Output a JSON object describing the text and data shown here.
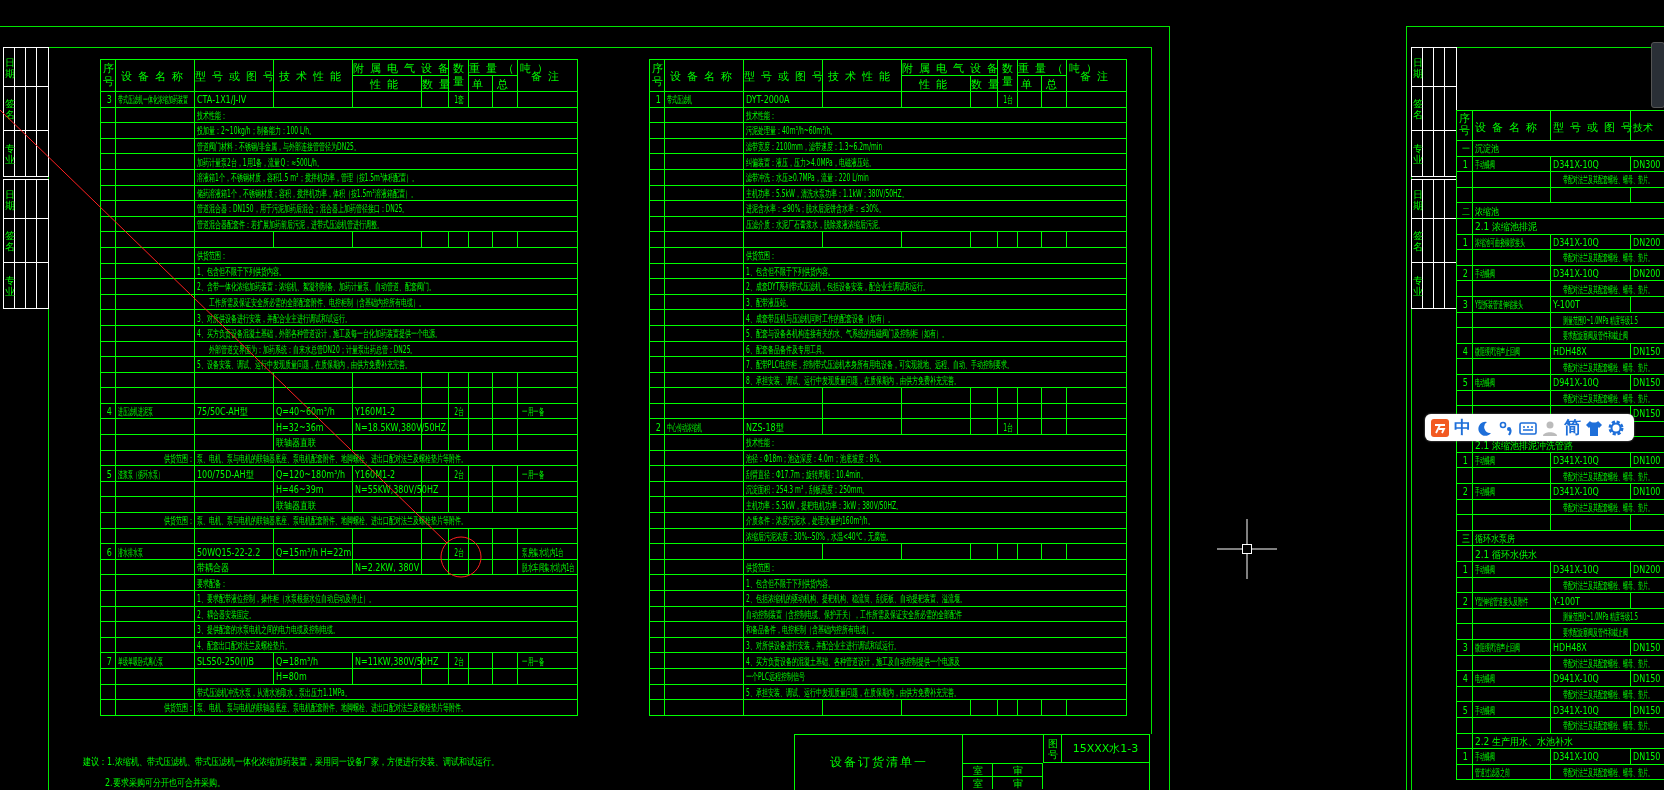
{
  "left_sheet": {
    "stamp_blocks": [
      [
        "日期",
        "签名",
        "专业"
      ],
      [
        "日期",
        "签名",
        "专业"
      ]
    ],
    "table": {
      "header": {
        "no": "序号",
        "name": "设备名称",
        "model": "型号或图号",
        "tech": "技术性能",
        "elec": "附属电气设备",
        "elec_perf": "性能",
        "elec_qty": "数量",
        "qty": "数量",
        "weight": "重量（吨）",
        "weight_unit": "单",
        "weight_total": "总",
        "remark": "备注"
      },
      "rows": [
        {
          "kind": "item",
          "no": "3",
          "name": "带式压滤机一体化浓缩加药装置",
          "model": "CTA-1X1/J-IV",
          "qty": "1套"
        },
        {
          "kind": "text",
          "text": "技术性能："
        },
        {
          "kind": "text",
          "text": "投加量：2~10kg/h；制备能力：100 L/h。"
        },
        {
          "kind": "text",
          "text": "管道阀门材料：不锈钢/非金属，与外部连接管管径为DN25。"
        },
        {
          "kind": "text",
          "text": "加药计量泵2台，1用1备，流量Q：≈500L/h。"
        },
        {
          "kind": "text",
          "text": "溶液箱1个，不锈钢材质，容积1.5 m³；搅拌机功率，管理（按1.5m³体积配置）。"
        },
        {
          "kind": "text",
          "text": "储药溶液箱1个，不锈钢材质；容积，搅拌机功率，体积（按1.5m³溶液箱配置）。"
        },
        {
          "kind": "text",
          "text": "管道混合器：DN150，用于污泥加药后混合；混合器上加药管径接口：DN25。"
        },
        {
          "kind": "text",
          "text": "管道混合器配套件：若扩展加药前后污泥，进带式压滤机管进行调整。"
        },
        {
          "kind": "blank"
        },
        {
          "kind": "text",
          "text": "供货范围："
        },
        {
          "kind": "text",
          "text": "1、包含但不限于下列供货内容。"
        },
        {
          "kind": "text",
          "text": "2、含带一体化浓缩加药装置：浓缩机、絮凝剂制备、加药计量泵、自动管道、配套阀门。"
        },
        {
          "kind": "text",
          "indent": true,
          "text": "工作所需及保证安全所必需的全部配套附件、电控柜制（含基础内控所有电缆）。"
        },
        {
          "kind": "text",
          "text": "3、对所供设备进行安装，并配合业主进行调试和试运行。"
        },
        {
          "kind": "text",
          "text": "4、买方负责设备混凝土基础，外部各种管道设计，施工及每一台化加药装置提供一个电源。"
        },
        {
          "kind": "text",
          "indent": true,
          "text": "外部管道交界面为：加药系统：自来水总管DN20；计量泵出药总管：DN25。"
        },
        {
          "kind": "text",
          "text": "5、设备安装、调试、运行中发现质量问题，在质保期内，由供方免费补充完善。"
        },
        {
          "kind": "blank"
        },
        {
          "kind": "blank"
        },
        {
          "kind": "item",
          "no": "4",
          "name": "进压滤机进泥泵",
          "model": "75/50C-AH型",
          "tech": "Q=40~60m³/h",
          "elec": "Y160M1-2",
          "qty": "2台",
          "remark": "一用一备"
        },
        {
          "kind": "item",
          "tech": "H=32~36m",
          "elec": "N=18.5KW,380V/50HZ"
        },
        {
          "kind": "item",
          "tech": "联轴器直联"
        },
        {
          "kind": "text",
          "label": "供货范围：",
          "text": "泵、电机、泵与电机的联轴器底座、泵电机配套附件、地脚螺栓、进出口配对法兰及螺栓垫片等附件。"
        },
        {
          "kind": "item",
          "no": "5",
          "name": "渣浆泵（循环水泵）",
          "model": "100/75D-AH型",
          "tech": "Q=120~180m³/h",
          "elec": "Y160M1-2",
          "qty": "2台",
          "remark": "一用一备"
        },
        {
          "kind": "item",
          "tech": "H=46~39m",
          "elec": "N=55KW,380V/50HZ"
        },
        {
          "kind": "item",
          "tech": "联轴器直联"
        },
        {
          "kind": "text",
          "label": "供货范围：",
          "text": "泵、电机、泵与电机的联轴器底座、泵电机配套附件、地脚螺栓、进出口配对法兰及螺栓垫片等附件。"
        },
        {
          "kind": "blank"
        },
        {
          "kind": "item",
          "no": "6",
          "name": "潜水排水泵",
          "model": "50WQ15-22-2.2",
          "tech": "Q=15m³/h H=22m",
          "qty": "2台",
          "remark": "泵房集水坑内1台"
        },
        {
          "kind": "item",
          "model": "带耦合器",
          "elec": "N=2.2KW, 380V",
          "remark": "脱水车间集水坑内1台"
        },
        {
          "kind": "text",
          "text": "要求配备："
        },
        {
          "kind": "text",
          "text": "1、要求配带液位控制，操作柜（水泵根据水位自动启动及停止）。"
        },
        {
          "kind": "text",
          "text": "2、耦合器安装固定。"
        },
        {
          "kind": "text",
          "text": "3、提供配套的水泵电机之间的电力电缆及控制电缆。"
        },
        {
          "kind": "text",
          "text": "4、配套出口配对法兰及螺栓垫片。"
        },
        {
          "kind": "item",
          "no": "7",
          "name": "单级单吸卧式离心泵",
          "model": "SLS50-250(I)B",
          "tech": "Q=18m³/h",
          "elec": "N=11KW,380V/50HZ",
          "qty": "2台",
          "remark": "一用一备"
        },
        {
          "kind": "item",
          "tech": "H=80m"
        },
        {
          "kind": "text",
          "text": "带式压滤机冲洗水泵，从清水池取水，泵出压力1.1MPa。"
        },
        {
          "kind": "text",
          "label": "供货范围：",
          "text": "泵、电机、泵与电机的联轴器底座、泵电机配套附件、地脚螺栓、进出口配对法兰及螺栓垫片等附件。"
        }
      ]
    }
  },
  "middle_table": {
    "header": {
      "no": "序号",
      "name": "设备名称",
      "model": "型号或图号",
      "tech": "技术性能",
      "elec": "附属电气设备",
      "elec_perf": "性能",
      "elec_qty": "数量",
      "qty": "数量",
      "weight": "重量（吨）",
      "weight_unit": "单",
      "weight_total": "总",
      "remark": "备注"
    },
    "rows": [
      {
        "kind": "item",
        "no": "1",
        "name": "带式压滤机",
        "model": "DYT-2000A",
        "qty": "1台"
      },
      {
        "kind": "text",
        "text": "技术性能："
      },
      {
        "kind": "text",
        "text": "污泥处理量：40m³/h~60m³/h。"
      },
      {
        "kind": "text",
        "text": "滤带宽度：2100mm，滤带速度：1.3~6.2m/min"
      },
      {
        "kind": "text",
        "text": "纠偏装置：液压，压力>4.0MPa，电磁液压站。"
      },
      {
        "kind": "text",
        "text": "滤带冲洗：水压≥0.7MPa，流量：220 L/min"
      },
      {
        "kind": "text",
        "text": "主机功率：5.5kW，清洗水泵功率：1.1kW；380V/50HZ。"
      },
      {
        "kind": "text",
        "text": "进泥含水率：≤90%；脱水后泥饼含水率：≤30%。"
      },
      {
        "kind": "text",
        "text": "压滤介质：水泥厂石膏浆水，脱除浆液浓缩后污泥。"
      },
      {
        "kind": "blank"
      },
      {
        "kind": "text",
        "text": "供货范围："
      },
      {
        "kind": "text",
        "text": "1、包含但不限于下列供货内容。"
      },
      {
        "kind": "text",
        "text": "2、成套DYT系列带式压滤机，包括设备安装，配合业主调试和运行。"
      },
      {
        "kind": "text",
        "text": "3、配带液压站。"
      },
      {
        "kind": "text",
        "text": "4、成套带压机与压滤机同时工作的配套设备（如有）。"
      },
      {
        "kind": "text",
        "text": "5、配套与设备各机构连接有关的水、气系统的电磁阀门及控制柜（如有）。"
      },
      {
        "kind": "text",
        "text": "6、配套备品备件及专用工具。"
      },
      {
        "kind": "text",
        "text": "7、配带PLC电控柜，控制带式压滤机本身所有用电设备，可实现就地、远程、自动、手动控制要求。"
      },
      {
        "kind": "text",
        "text": "8、承担安装、调试、运行中发现质量问题，在质保期内，由供方免费补充完善。"
      },
      {
        "kind": "blank"
      },
      {
        "kind": "blank"
      },
      {
        "kind": "item",
        "no": "2",
        "name": "中心传动浓缩机",
        "model": "NZS-18型",
        "qty": "1台"
      },
      {
        "kind": "text",
        "text": "技术性能："
      },
      {
        "kind": "text",
        "text": "池径：Φ18m；池边深度：4.0m；池底坡度：8%。"
      },
      {
        "kind": "text",
        "text": "刮臂直径：Φ17.7m；旋转周期：10.4min。"
      },
      {
        "kind": "text",
        "text": "沉淀面积：254.3 m³，刮板高度：250mm。"
      },
      {
        "kind": "text",
        "text": "主机功率：5.5kW，提耙电机功率：3kW；380V/50HZ。"
      },
      {
        "kind": "text",
        "text": "介质条件：浓度污泥水，处理水量约160m³/h。"
      },
      {
        "kind": "text",
        "text": "浓缩后污泥浓度：30%--50%，水温<40℃，无腐蚀。"
      },
      {
        "kind": "blank"
      },
      {
        "kind": "text",
        "text": "供货范围："
      },
      {
        "kind": "text",
        "text": "1、包含但不限于下列供货内容。"
      },
      {
        "kind": "text",
        "text": "2、包括浓缩机的驱动机构、提耙机构、稳流筒、刮泥板、自动提耙装置、溢流堰。"
      },
      {
        "kind": "text",
        "text": "自动控制装置（含控制电缆、保护开关），工作所需及保证安全所必需的全部配件"
      },
      {
        "kind": "text",
        "text": "和备品备件，电控柜制（含基础内控所有电缆）。"
      },
      {
        "kind": "text",
        "text": "3、对所供设备进行安装，并配合业主进行调试和试运行。"
      },
      {
        "kind": "text",
        "text": "4、买方负责设备的混凝土基础、各种管道设计，施工及自动控制提供一个电源及"
      },
      {
        "kind": "text",
        "text": "一个PLC远程控制信号"
      },
      {
        "kind": "text",
        "text": "5、承担安装、调试、运行中发现质量问题，在质保期内，由供方免费补充完善。"
      },
      {
        "kind": "blank"
      }
    ]
  },
  "notes": [
    "建议：1.浓缩机、带式压滤机、带式压滤机一体化浓缩加药装置，采用同一设备厂家，方便进行安装、调试和试运行。",
    "2.要求采购可分开也可合并采购。"
  ],
  "title_block": {
    "title": "设备订货清单一",
    "drawing_no_label": "图号",
    "drawing_no": "15XXX水1-3",
    "labels": [
      "室",
      "审",
      "室",
      "审"
    ]
  },
  "right_sheet": {
    "stamp_blocks": [
      [
        "日期",
        "签名",
        "专业"
      ],
      [
        "日期",
        "签名",
        "专业"
      ]
    ],
    "table": {
      "header": {
        "no": "序号",
        "name": "设备名称",
        "model": "型号或图号",
        "tech": "技术"
      },
      "rows": [
        {
          "kind": "section",
          "no": "一",
          "text": "沉淀池"
        },
        {
          "kind": "item",
          "no": "1",
          "name": "手动蝶阀",
          "model": "D341X-10Q",
          "tech": "DN300"
        },
        {
          "kind": "note",
          "text": "带配对法兰及其配套螺栓、螺母、垫片。"
        },
        {
          "kind": "blank"
        },
        {
          "kind": "section",
          "no": "二",
          "text": "浓缩池"
        },
        {
          "kind": "subsection",
          "text": "2.1 浓缩池排泥"
        },
        {
          "kind": "item",
          "no": "1",
          "name": "浓缩池可曲挠橡胶接头",
          "model": "D341X-10Q",
          "tech": "DN200"
        },
        {
          "kind": "note",
          "text": "带配对法兰及其配套螺栓、螺母、垫片。"
        },
        {
          "kind": "item",
          "no": "2",
          "name": "手动蝶阀",
          "model": "D341X-10Q",
          "tech": "DN200"
        },
        {
          "kind": "note",
          "text": "带配对法兰及其配套螺栓、螺母、垫片。"
        },
        {
          "kind": "item",
          "no": "3",
          "name": "Y型拆装管道伸缩接头",
          "model": "Y-100T"
        },
        {
          "kind": "note",
          "text": "测量范围0~1.0MPa 精度等级1.5"
        },
        {
          "kind": "note",
          "text": "要求配旋塞阀及管件和截止阀"
        },
        {
          "kind": "item",
          "no": "4",
          "name": "微阻缓闭消声止回阀",
          "model": "HDH48X",
          "tech": "DN150"
        },
        {
          "kind": "note",
          "text": "带配对法兰及其配套螺栓、螺母、垫片。"
        },
        {
          "kind": "item",
          "no": "5",
          "name": "电动蝶阀",
          "model": "D941X-10Q",
          "tech": "DN150"
        },
        {
          "kind": "note",
          "text": "带配对法兰及其配套螺栓、螺母、垫片。"
        },
        {
          "kind": "item",
          "tech": "DN150"
        },
        {
          "kind": "blank"
        },
        {
          "kind": "subsection",
          "text": "2.1 浓缩池排泥冲洗管路"
        },
        {
          "kind": "item",
          "no": "1",
          "name": "手动蝶阀",
          "model": "D341X-10Q",
          "tech": "DN100"
        },
        {
          "kind": "note",
          "text": "带配对法兰及其配套螺栓、螺母、垫片。"
        },
        {
          "kind": "item",
          "no": "2",
          "name": "手动蝶阀",
          "model": "D341X-10Q",
          "tech": "DN100"
        },
        {
          "kind": "note",
          "text": "带配对法兰及其配套螺栓、螺母、垫片。"
        },
        {
          "kind": "blank"
        },
        {
          "kind": "section",
          "no": "三",
          "text": "循环水泵房"
        },
        {
          "kind": "subsection",
          "text": "2.1 循环水供水"
        },
        {
          "kind": "item",
          "no": "1",
          "name": "手动蝶阀",
          "model": "D341X-10Q",
          "tech": "DN200"
        },
        {
          "kind": "note",
          "text": "带配对法兰及其配套螺栓、螺母、垫片。"
        },
        {
          "kind": "item",
          "no": "2",
          "name": "Y型伸缩管道接头及附件",
          "model": "Y-100T"
        },
        {
          "kind": "note",
          "text": "测量范围0~1.0MPa 精度等级1.5"
        },
        {
          "kind": "note",
          "text": "要求配旋塞阀及管件和截止阀"
        },
        {
          "kind": "item",
          "no": "3",
          "name": "微阻缓闭消声止回阀",
          "model": "HDH48X",
          "tech": "DN150"
        },
        {
          "kind": "note",
          "text": "带配对法兰及其配套螺栓、螺母、垫片。"
        },
        {
          "kind": "item",
          "no": "4",
          "name": "电动蝶阀",
          "model": "D941X-10Q",
          "tech": "DN150"
        },
        {
          "kind": "note",
          "text": "带配对法兰及其配套螺栓、螺母、垫片。"
        },
        {
          "kind": "item",
          "no": "5",
          "name": "手动蝶阀",
          "model": "D341X-10Q",
          "tech": "DN150"
        },
        {
          "kind": "note",
          "text": "带配对法兰及其配套螺栓、螺母、垫片。"
        },
        {
          "kind": "subsection",
          "text": "2.2 生产用水、水池补水"
        },
        {
          "kind": "item",
          "no": "1",
          "name": "手动蝶阀",
          "model": "D341X-10Q",
          "tech": "DN150"
        },
        {
          "kind": "note",
          "name": "管道过滤器之前",
          "text": "带配对法兰及其配套螺栓、螺母、垫片。"
        }
      ]
    }
  },
  "ime_toolbar": {
    "items": [
      {
        "kind": "logo"
      },
      {
        "kind": "text",
        "text": "中"
      },
      {
        "kind": "moon"
      },
      {
        "kind": "punct"
      },
      {
        "kind": "keyboard"
      },
      {
        "kind": "person"
      },
      {
        "kind": "text",
        "text": "简"
      },
      {
        "kind": "shirt"
      },
      {
        "kind": "gear"
      }
    ]
  }
}
